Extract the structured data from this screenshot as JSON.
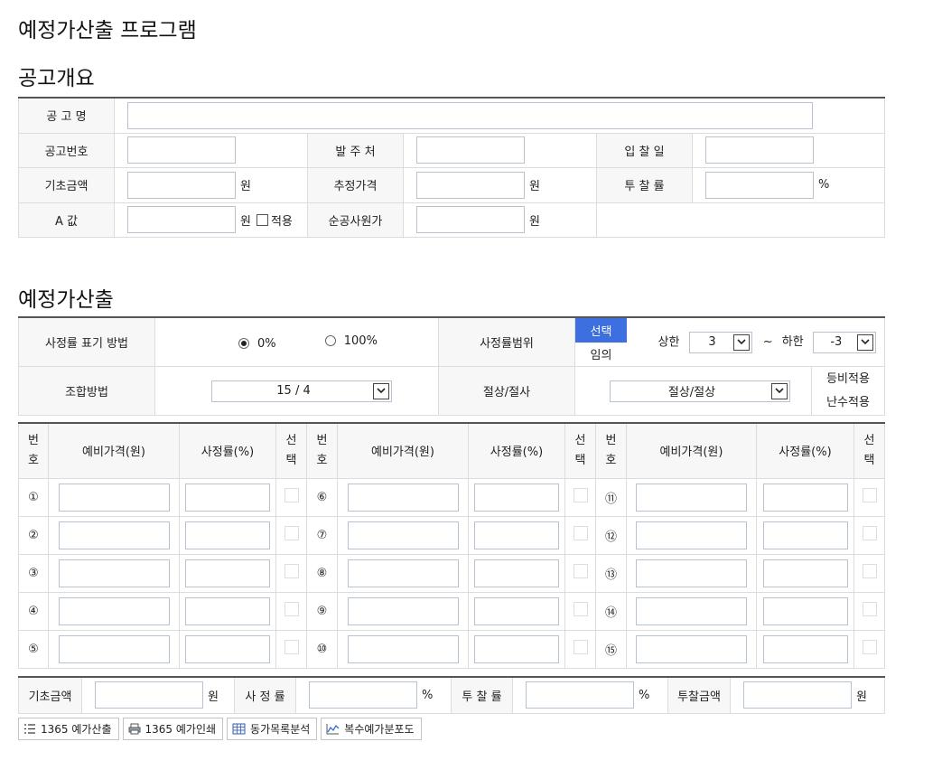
{
  "page_title": "예정가산출 프로그램",
  "notice": {
    "section_title": "공고개요",
    "labels": {
      "name": "공 고 명",
      "number": "공고번호",
      "orderer": "발 주 처",
      "bid_date": "입 찰 일",
      "base_amount": "기초금액",
      "estimated_price": "추정가격",
      "bid_rate": "투 찰 률",
      "a_value": "A 값",
      "net_cost": "순공사원가"
    },
    "units": {
      "won": "원",
      "percent": "%"
    },
    "apply_label": "적용"
  },
  "calc": {
    "section_title": "예정가산출",
    "rate_display_label": "사정률 표기 방법",
    "radio_0": "0%",
    "radio_100": "100%",
    "rate_range_label": "사정률범위",
    "toggle_select": "선택",
    "toggle_arbitrary": "임의",
    "upper_label": "상한",
    "upper_value": "3",
    "tilde": "~",
    "lower_label": "하한",
    "lower_value": "-3",
    "combo_label": "조합방법",
    "combo_value": "15 / 4",
    "round_label": "절상/절사",
    "round_value": "절상/절상",
    "equal_ratio": "등비적용",
    "random": "난수적용"
  },
  "grid": {
    "headers": {
      "num": "번\n호",
      "price": "예비가격(원)",
      "rate": "사정률(%)",
      "select": "선\n택"
    },
    "numbers": [
      "①",
      "②",
      "③",
      "④",
      "⑤",
      "⑥",
      "⑦",
      "⑧",
      "⑨",
      "⑩",
      "⑪",
      "⑫",
      "⑬",
      "⑭",
      "⑮"
    ]
  },
  "summary": {
    "base_amount": "기초금액",
    "rate": "사 정 률",
    "bid_rate": "투 찰 률",
    "bid_amount": "투찰금액",
    "won": "원",
    "percent": "%"
  },
  "buttons": {
    "calc_1365": "1365 예가산출",
    "print_1365": "1365 예가인쇄",
    "same_analysis": "동가목록분석",
    "multi_dist": "복수예가분포도"
  },
  "colors": {
    "accent": "#3e6fe0",
    "border": "#dcdcdc",
    "header_bg": "#f7f7f7",
    "input_border": "#b9c3cf"
  }
}
